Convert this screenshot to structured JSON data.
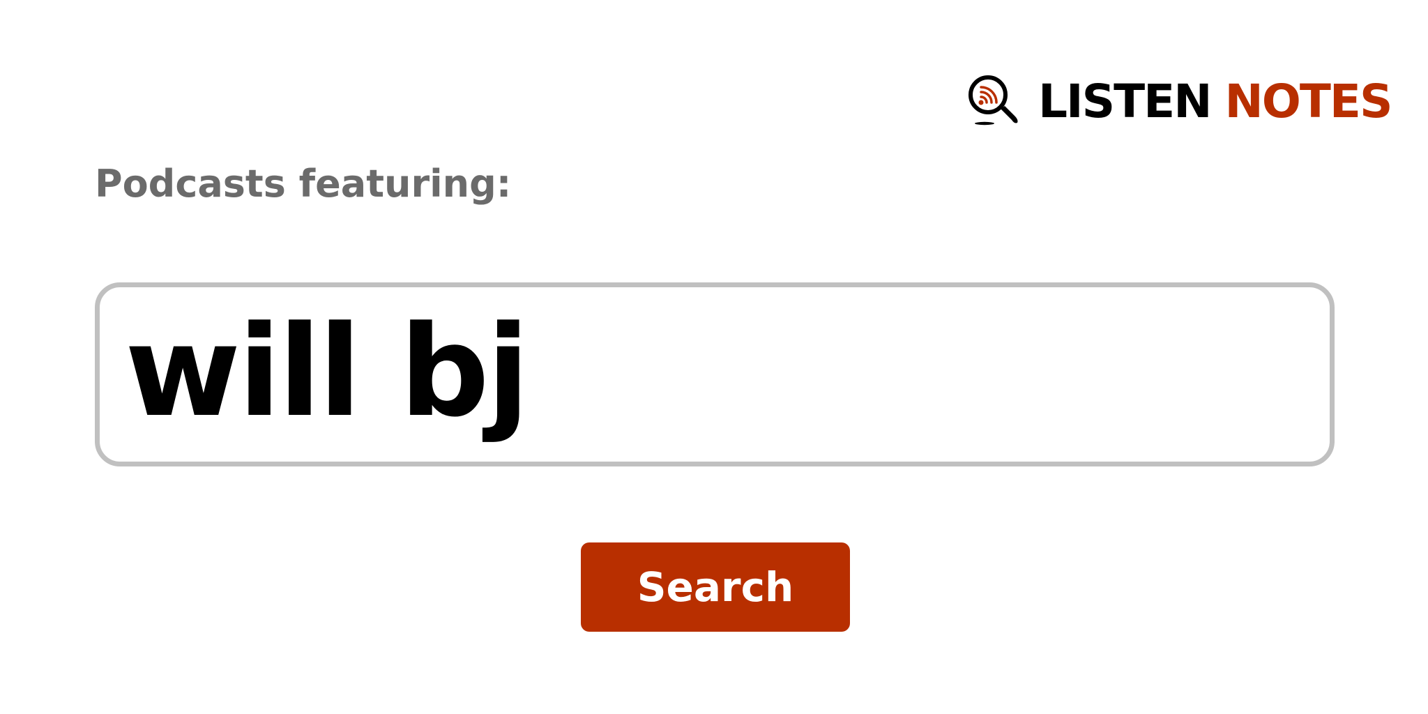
{
  "logo": {
    "icon": "podcast-search-icon",
    "word_1": "LISTEN",
    "word_2": "NOTES",
    "brand_color": "#b82f00",
    "text_color": "#000000"
  },
  "heading": {
    "text": "Podcasts featuring:",
    "color": "#6b6b6b"
  },
  "search": {
    "value": "will bj",
    "placeholder": "",
    "border_color": "#c0c0c0"
  },
  "button": {
    "label": "Search",
    "background": "#b82f00",
    "text_color": "#ffffff"
  }
}
